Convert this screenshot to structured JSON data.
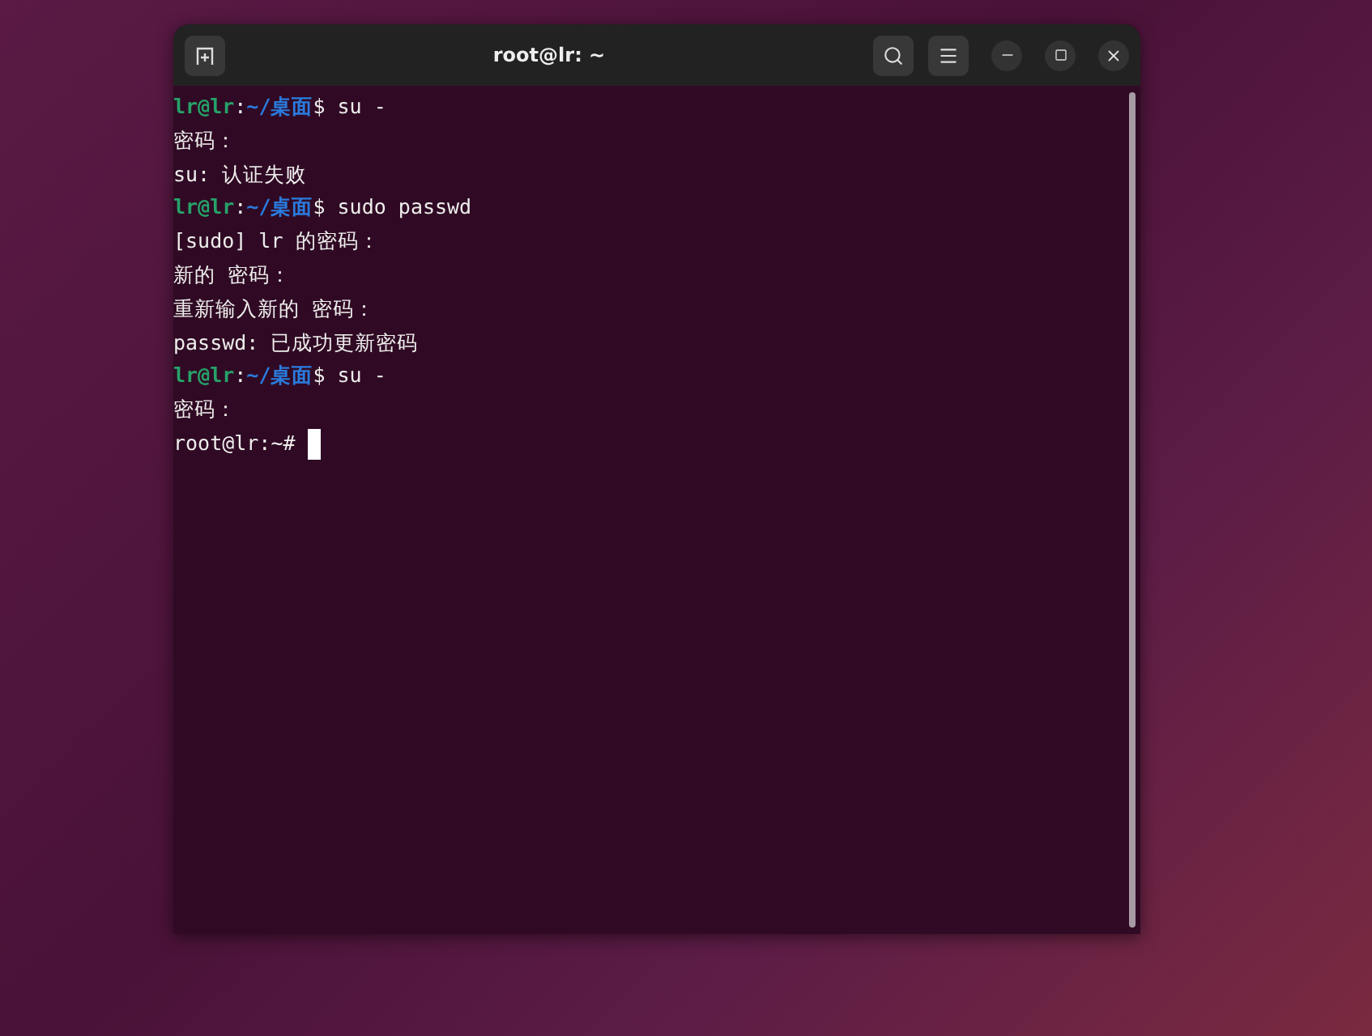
{
  "window": {
    "title": "root@lr: ~"
  },
  "terminal": {
    "lines": [
      {
        "kind": "prompt",
        "user": "lr@lr",
        "sep": ":",
        "path": "~/桌面",
        "command": "$ su -"
      },
      {
        "kind": "output",
        "text": "密码："
      },
      {
        "kind": "output",
        "text": "su: 认证失败"
      },
      {
        "kind": "prompt",
        "user": "lr@lr",
        "sep": ":",
        "path": "~/桌面",
        "command": "$ sudo passwd"
      },
      {
        "kind": "output",
        "text": "[sudo] lr 的密码："
      },
      {
        "kind": "output",
        "text": "新的 密码："
      },
      {
        "kind": "output",
        "text": "重新输入新的 密码："
      },
      {
        "kind": "output",
        "text": "passwd: 已成功更新密码"
      },
      {
        "kind": "prompt",
        "user": "lr@lr",
        "sep": ":",
        "path": "~/桌面",
        "command": "$ su -"
      },
      {
        "kind": "output",
        "text": "密码："
      },
      {
        "kind": "cursor",
        "text": "root@lr:~#"
      }
    ]
  }
}
